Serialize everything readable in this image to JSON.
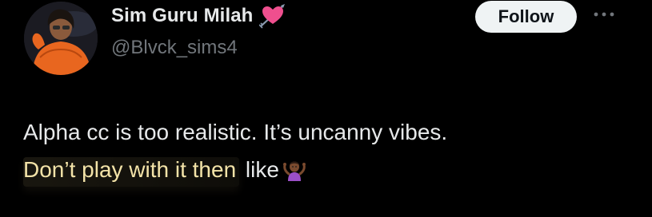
{
  "author": {
    "display_name": "Sim Guru Milah",
    "handle": "@Blvck_sims4",
    "name_emoji": "heart-with-arrow-icon",
    "avatar": "avatar"
  },
  "actions": {
    "follow_label": "Follow",
    "more_icon": "more-horizontal-icon"
  },
  "tweet": {
    "line1": "Alpha cc is too realistic. It’s uncanny vibes.",
    "line2_highlight": "Don’t play with it then",
    "line2_rest": " like",
    "trailing_emoji": "person-shrugging-icon"
  },
  "colors": {
    "background": "#000000",
    "text_primary": "#e7e9ea",
    "text_secondary": "#71767b",
    "follow_bg": "#eff3f4",
    "highlight_text": "#f3e3a8"
  }
}
